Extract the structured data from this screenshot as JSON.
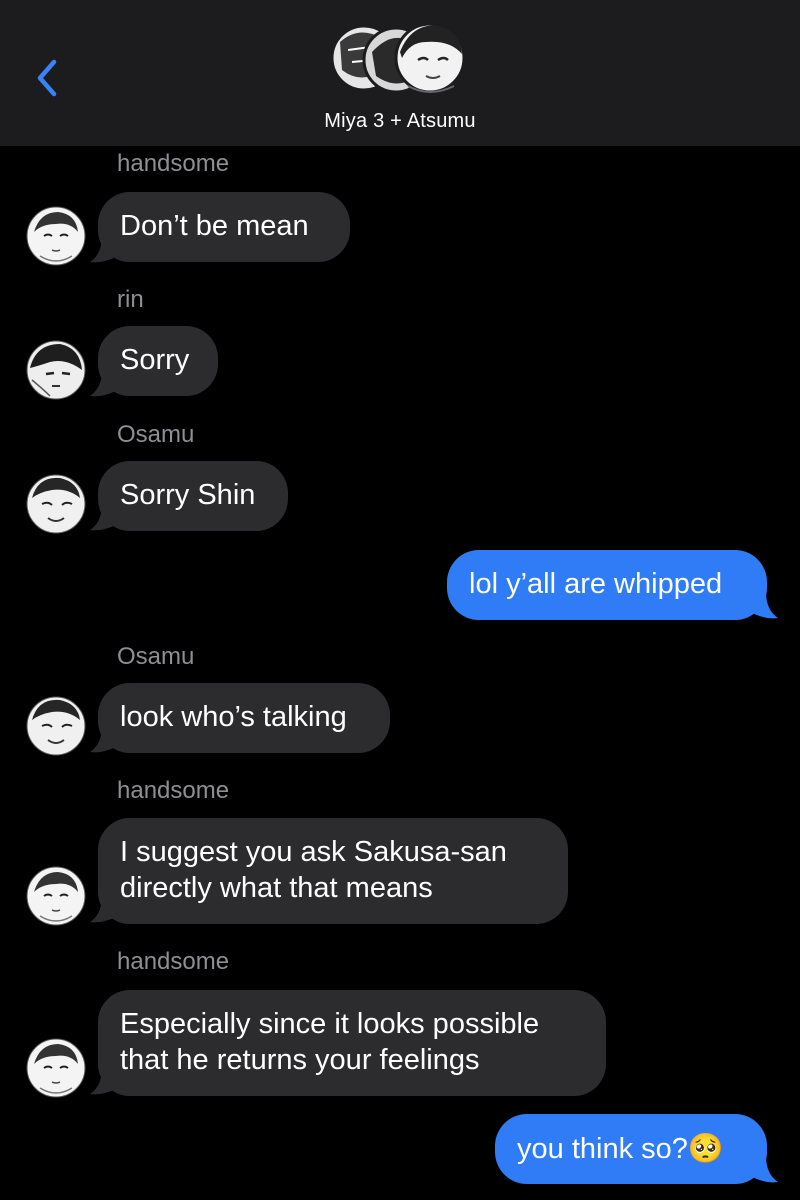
{
  "header": {
    "title": "Miya 3 + Atsumu",
    "back_icon": "chevron-left-icon",
    "accent_color": "#3a82f7"
  },
  "colors": {
    "incoming_bubble": "#2c2c2e",
    "outgoing_bubble": "#2f7cf6",
    "sender_name": "#8e8e93",
    "background": "#000000"
  },
  "messages": [
    {
      "sender": "handsome",
      "text": "Don’t be mean"
    },
    {
      "sender": "rin",
      "text": "Sorry"
    },
    {
      "sender": "Osamu",
      "text": "Sorry Shin"
    },
    {
      "sender": "me",
      "text": "lol y’all are whipped"
    },
    {
      "sender": "Osamu",
      "text": "look who’s talking"
    },
    {
      "sender": "handsome",
      "lines": [
        "I suggest you ask Sakusa-san",
        "directly what that means"
      ]
    },
    {
      "sender": "handsome",
      "lines": [
        "Especially since it looks possible",
        "that he returns your feelings"
      ]
    },
    {
      "sender": "me",
      "text": "you think so?",
      "emoji": "🥺"
    }
  ]
}
